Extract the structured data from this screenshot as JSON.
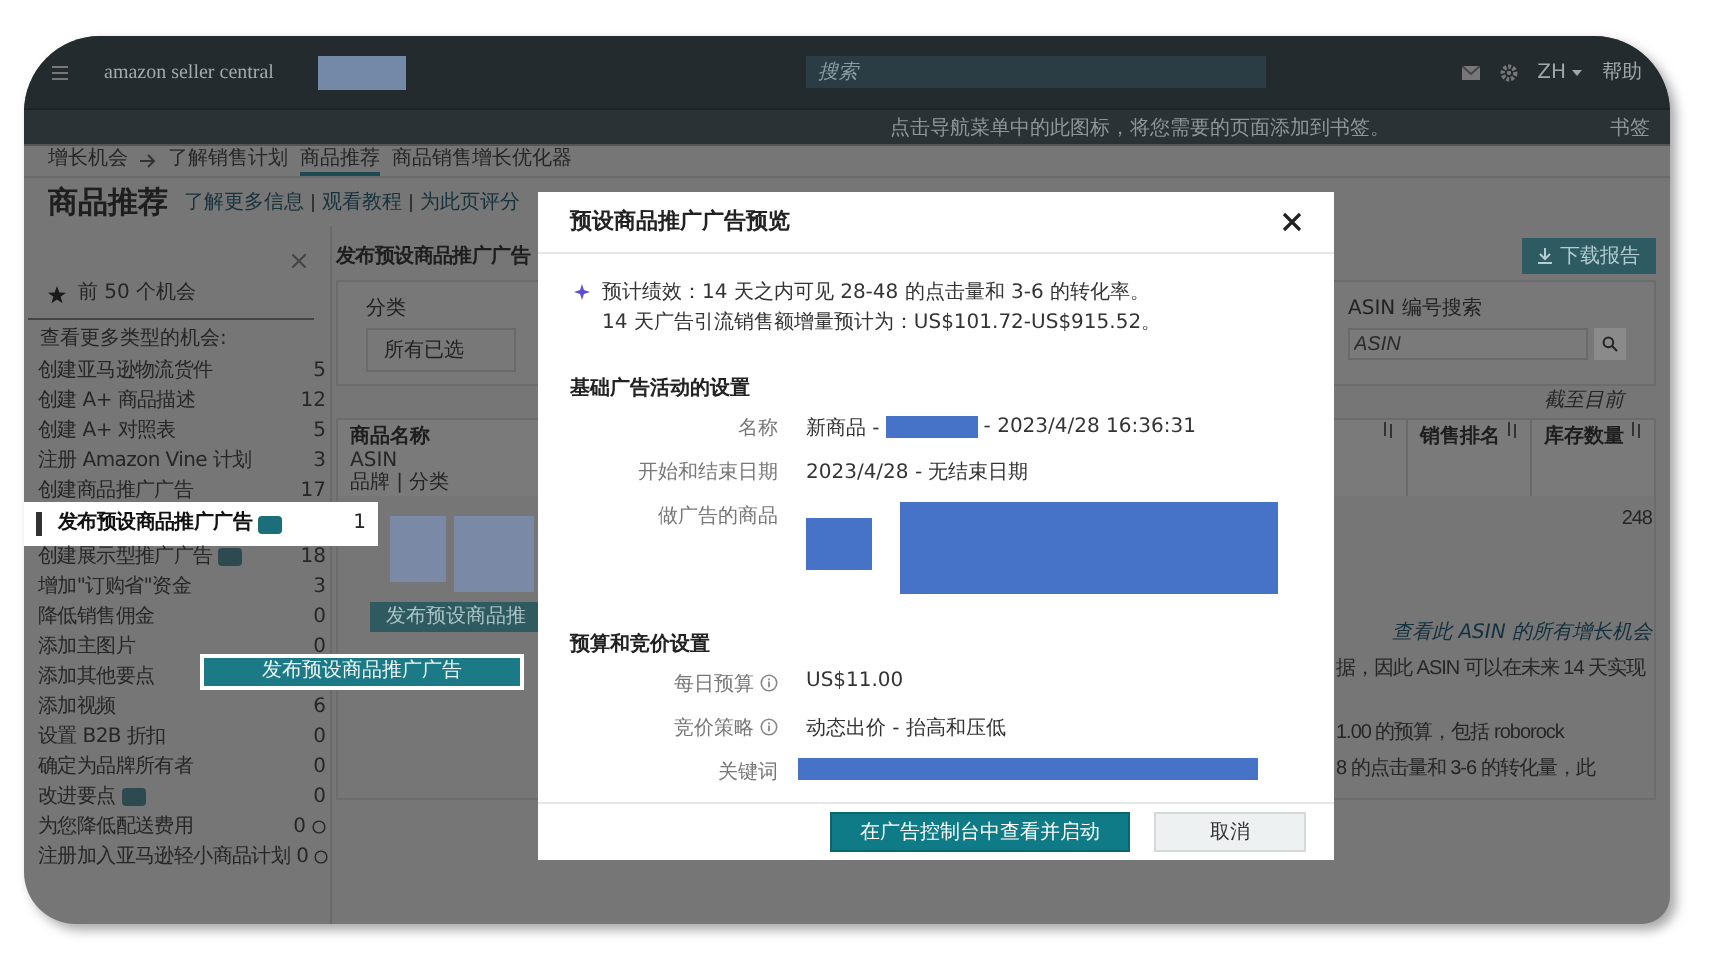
{
  "top_bar": {
    "logo": "amazon seller central",
    "search": {
      "placeholder": "搜索"
    },
    "language": "ZH",
    "help": "帮助"
  },
  "notice_bar": {
    "text": "点击导航菜单中的此图标，将您需要的页面添加到书签。",
    "bookmark": "书签"
  },
  "breadcrumb": [
    {
      "label": "增长机会",
      "selected": false
    },
    {
      "label": "了解销售计划",
      "selected": false
    },
    {
      "label": "商品推荐",
      "selected": true
    },
    {
      "label": "商品销售增长优化器",
      "selected": false
    }
  ],
  "page": {
    "title": "商品推荐",
    "links": [
      "了解更多信息",
      "观看教程",
      "为此页评分"
    ]
  },
  "sidebar": {
    "top": "前 50 个机会",
    "heading": "查看更多类型的机会:",
    "items": [
      {
        "label": "创建亚马逊物流货件",
        "count": "5",
        "selected": false,
        "badge": false,
        "info": false
      },
      {
        "label": "创建 A+ 商品描述",
        "count": "12",
        "selected": false,
        "badge": false,
        "info": false
      },
      {
        "label": "创建 A+ 对照表",
        "count": "5",
        "selected": false,
        "badge": false,
        "info": false
      },
      {
        "label": "注册 Amazon Vine 计划",
        "count": "3",
        "selected": false,
        "badge": false,
        "info": false
      },
      {
        "label": "创建商品推广广告",
        "count": "17",
        "selected": false,
        "badge": false,
        "info": false
      },
      {
        "label": "发布预设商品推广广告",
        "count": "1",
        "selected": true,
        "badge": true,
        "info": false
      },
      {
        "label": "创建展示型推广广告",
        "count": "18",
        "selected": false,
        "badge": true,
        "info": false
      },
      {
        "label": "增加\"订购省\"资金",
        "count": "3",
        "selected": false,
        "badge": false,
        "info": false
      },
      {
        "label": "降低销售佣金",
        "count": "0",
        "selected": false,
        "badge": false,
        "info": false
      },
      {
        "label": "添加主图片",
        "count": "0",
        "selected": false,
        "badge": false,
        "info": false
      },
      {
        "label": "添加其他要点",
        "selected": false,
        "badge": false,
        "info": false
      },
      {
        "label": "添加视频",
        "count": "6",
        "selected": false,
        "badge": false,
        "info": false
      },
      {
        "label": "设置 B2B 折扣",
        "count": "0",
        "selected": false,
        "badge": false,
        "info": false
      },
      {
        "label": "确定为品牌所有者",
        "count": "0",
        "selected": false,
        "badge": false,
        "info": false
      },
      {
        "label": "改进要点",
        "count": "0",
        "selected": false,
        "badge": true,
        "info": false
      },
      {
        "label": "为您降低配送费用",
        "count": "0",
        "selected": false,
        "badge": false,
        "info": true
      },
      {
        "label": "注册加入亚马逊轻小商品计划",
        "count": "0",
        "selected": false,
        "badge": false,
        "info": true
      }
    ]
  },
  "callout_button": "发布预设商品推广广告",
  "main": {
    "title": "发布预设商品推广广告",
    "download_button": "下载报告",
    "filters": {
      "category_label": "分类",
      "category_value": "所有已选",
      "search_label": "ASIN 编号搜索",
      "search_placeholder": "ASIN"
    },
    "as_of": "截至目前",
    "table": {
      "columns": [
        {
          "title": "商品名称",
          "sub": [
            "ASIN",
            "品牌 | 分类"
          ]
        },
        {
          "title": "销售排名"
        },
        {
          "title": "库存数量"
        }
      ],
      "row": {
        "button": "发布预设商品推",
        "stock": "248",
        "link": "查看此 ASIN 的所有增长机会",
        "notes": [
          "据，因此 ASIN 可以在未来 14 天实现",
          "1.00 的预算，包括 roborock",
          "8 的点击量和 3-6 的转化量，此"
        ]
      }
    }
  },
  "modal": {
    "title": "预设商品推广广告预览",
    "estimate": [
      "预计绩效：14 天之内可见 28-48 的点击量和 3-6 的转化率。",
      "14 天广告引流销售额增量预计为：US$101.72-US$915.52。"
    ],
    "sections": [
      {
        "title": "基础广告活动的设置",
        "rows": [
          {
            "label": "名称",
            "kind": "name",
            "prefix": "新商品 -",
            "suffix": "- 2023/4/28 16:36:31",
            "info": false
          },
          {
            "label": "开始和结束日期",
            "kind": "text",
            "value": "2023/4/28 - 无结束日期",
            "info": false
          },
          {
            "label": "做广告的商品",
            "kind": "products",
            "info": false
          }
        ]
      },
      {
        "title": "预算和竞价设置",
        "rows": [
          {
            "label": "每日预算",
            "kind": "text",
            "value": "US$11.00",
            "info": true
          },
          {
            "label": "竞价策略",
            "kind": "text",
            "value": "动态出价 - 抬高和压低",
            "info": true
          },
          {
            "label": "关键词",
            "kind": "keywords",
            "info": false
          }
        ]
      }
    ],
    "primary_button": "在广告控制台中查看并启动",
    "cancel_button": "取消"
  }
}
